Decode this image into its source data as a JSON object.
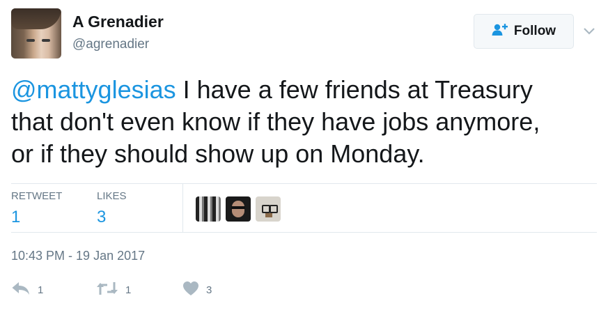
{
  "author": {
    "name": "A Grenadier",
    "handle": "@agrenadier"
  },
  "follow_button": {
    "label": "Follow",
    "icon": "add-user-icon"
  },
  "tweet": {
    "mention": "@mattyglesias",
    "line1": " I have a few friends at Treasury",
    "line2": "that don't even know if they have jobs anymore,",
    "line3": "or if they should show up on Monday."
  },
  "stats": {
    "retweets_label": "RETWEET",
    "retweets_count": "1",
    "likes_label": "LIKES",
    "likes_count": "3"
  },
  "timestamp": "10:43 PM - 19 Jan 2017",
  "actions": {
    "reply_count": "1",
    "retweet_count": "1",
    "like_count": "3"
  },
  "colors": {
    "accent": "#1b95e0",
    "secondary_text": "#657786",
    "primary_text": "#14171a",
    "border": "#e1e8ed",
    "action_icon": "#aab8c2"
  }
}
